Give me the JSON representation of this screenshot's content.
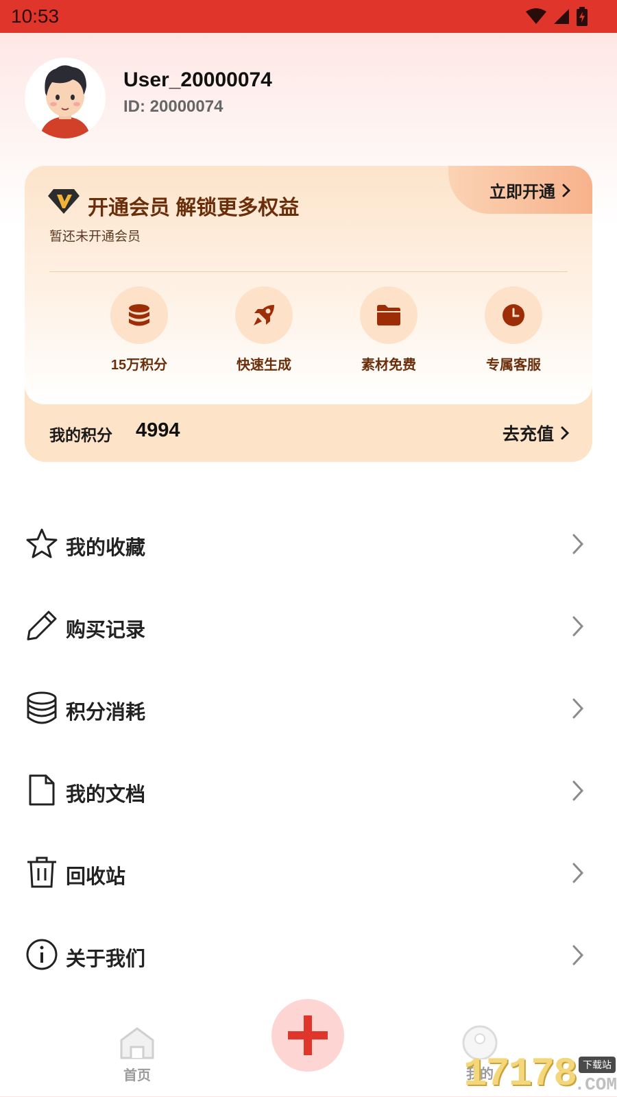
{
  "status_bar": {
    "time": "10:53"
  },
  "profile": {
    "username": "User_20000074",
    "user_id": "ID: 20000074"
  },
  "vip": {
    "title": "开通会员 解锁更多权益",
    "subtitle": "暂还未开通会员",
    "cta": "立即开通",
    "perks": [
      {
        "label": "15万积分",
        "icon": "coins-stack-icon"
      },
      {
        "label": "快速生成",
        "icon": "rocket-icon"
      },
      {
        "label": "素材免费",
        "icon": "folder-icon"
      },
      {
        "label": "专属客服",
        "icon": "clock-icon"
      }
    ],
    "points_label": "我的积分",
    "points_value": "4994",
    "recharge": "去充值"
  },
  "menu": [
    {
      "label": "我的收藏",
      "icon": "star-icon"
    },
    {
      "label": "购买记录",
      "icon": "pencil-icon"
    },
    {
      "label": "积分消耗",
      "icon": "coins-stack-icon"
    },
    {
      "label": "我的文档",
      "icon": "document-icon"
    },
    {
      "label": "回收站",
      "icon": "trash-icon"
    },
    {
      "label": "关于我们",
      "icon": "info-icon"
    }
  ],
  "bottom_nav": {
    "home": "首页",
    "mine": "我的"
  },
  "watermark": {
    "digits": "17178",
    "domain": ".COM",
    "tag": "下载站"
  },
  "colors": {
    "accent": "#e0352b",
    "vip_text": "#6a2e0b",
    "vip_bg": "#fde3c8"
  }
}
